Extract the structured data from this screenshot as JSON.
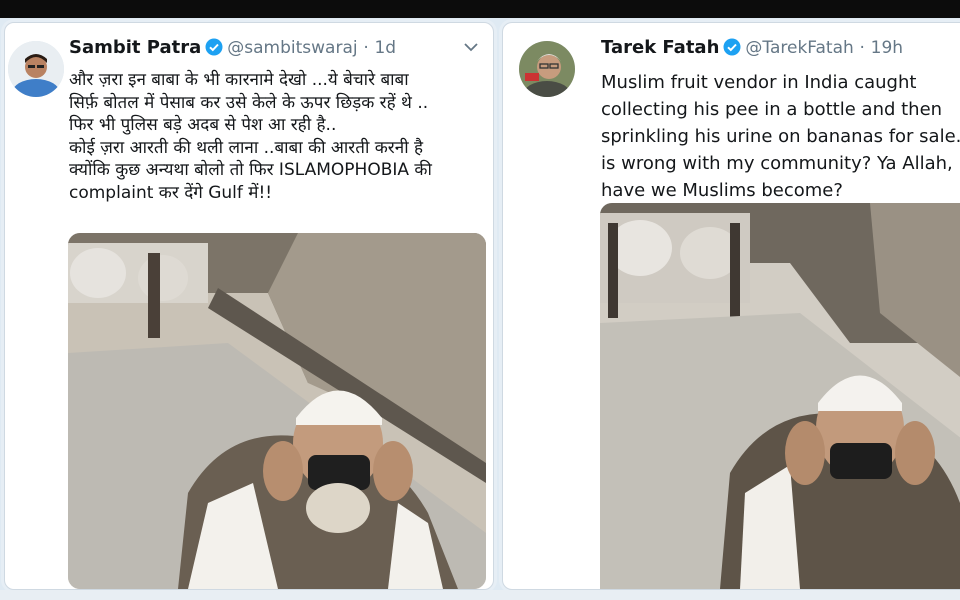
{
  "tweets": [
    {
      "author_name": "Sambit Patra",
      "handle": "@sambitswaraj",
      "separator": "·",
      "time": "1d",
      "text_lines": [
        "और ज़रा इन बाबा के भी कारनामे देखो ...ये बेचारे बाबा",
        "सिर्फ़ बोतल में पेसाब कर उसे केले के ऊपर छिड़क रहें थे ..",
        "फिर भी पुलिस बड़े अदब से पेश आ रही है..",
        "कोई ज़रा आरती की थली लाना ..बाबा की आरती करनी है",
        "क्योंकि कुछ अन्यथा बोलो तो फिर ISLAMOPHOBIA की",
        "complaint कर देंगे Gulf में!!"
      ]
    },
    {
      "author_name": "Tarek Fatah",
      "handle": "@TarekFatah",
      "separator": "·",
      "time": "19h",
      "text_lines": [
        "Muslim fruit vendor in India caught",
        "collecting his pee in a bottle and then",
        "sprinkling his urine on bananas for sale.",
        "is wrong with my community? Ya Allah,",
        "have we Muslims become?"
      ]
    }
  ],
  "colors": {
    "verified": "#1da1f2",
    "text": "#14171a",
    "muted": "#657786",
    "background": "#dfeaf3"
  },
  "icons": {
    "verified": "verified-badge-icon",
    "menu": "chevron-down-icon"
  }
}
